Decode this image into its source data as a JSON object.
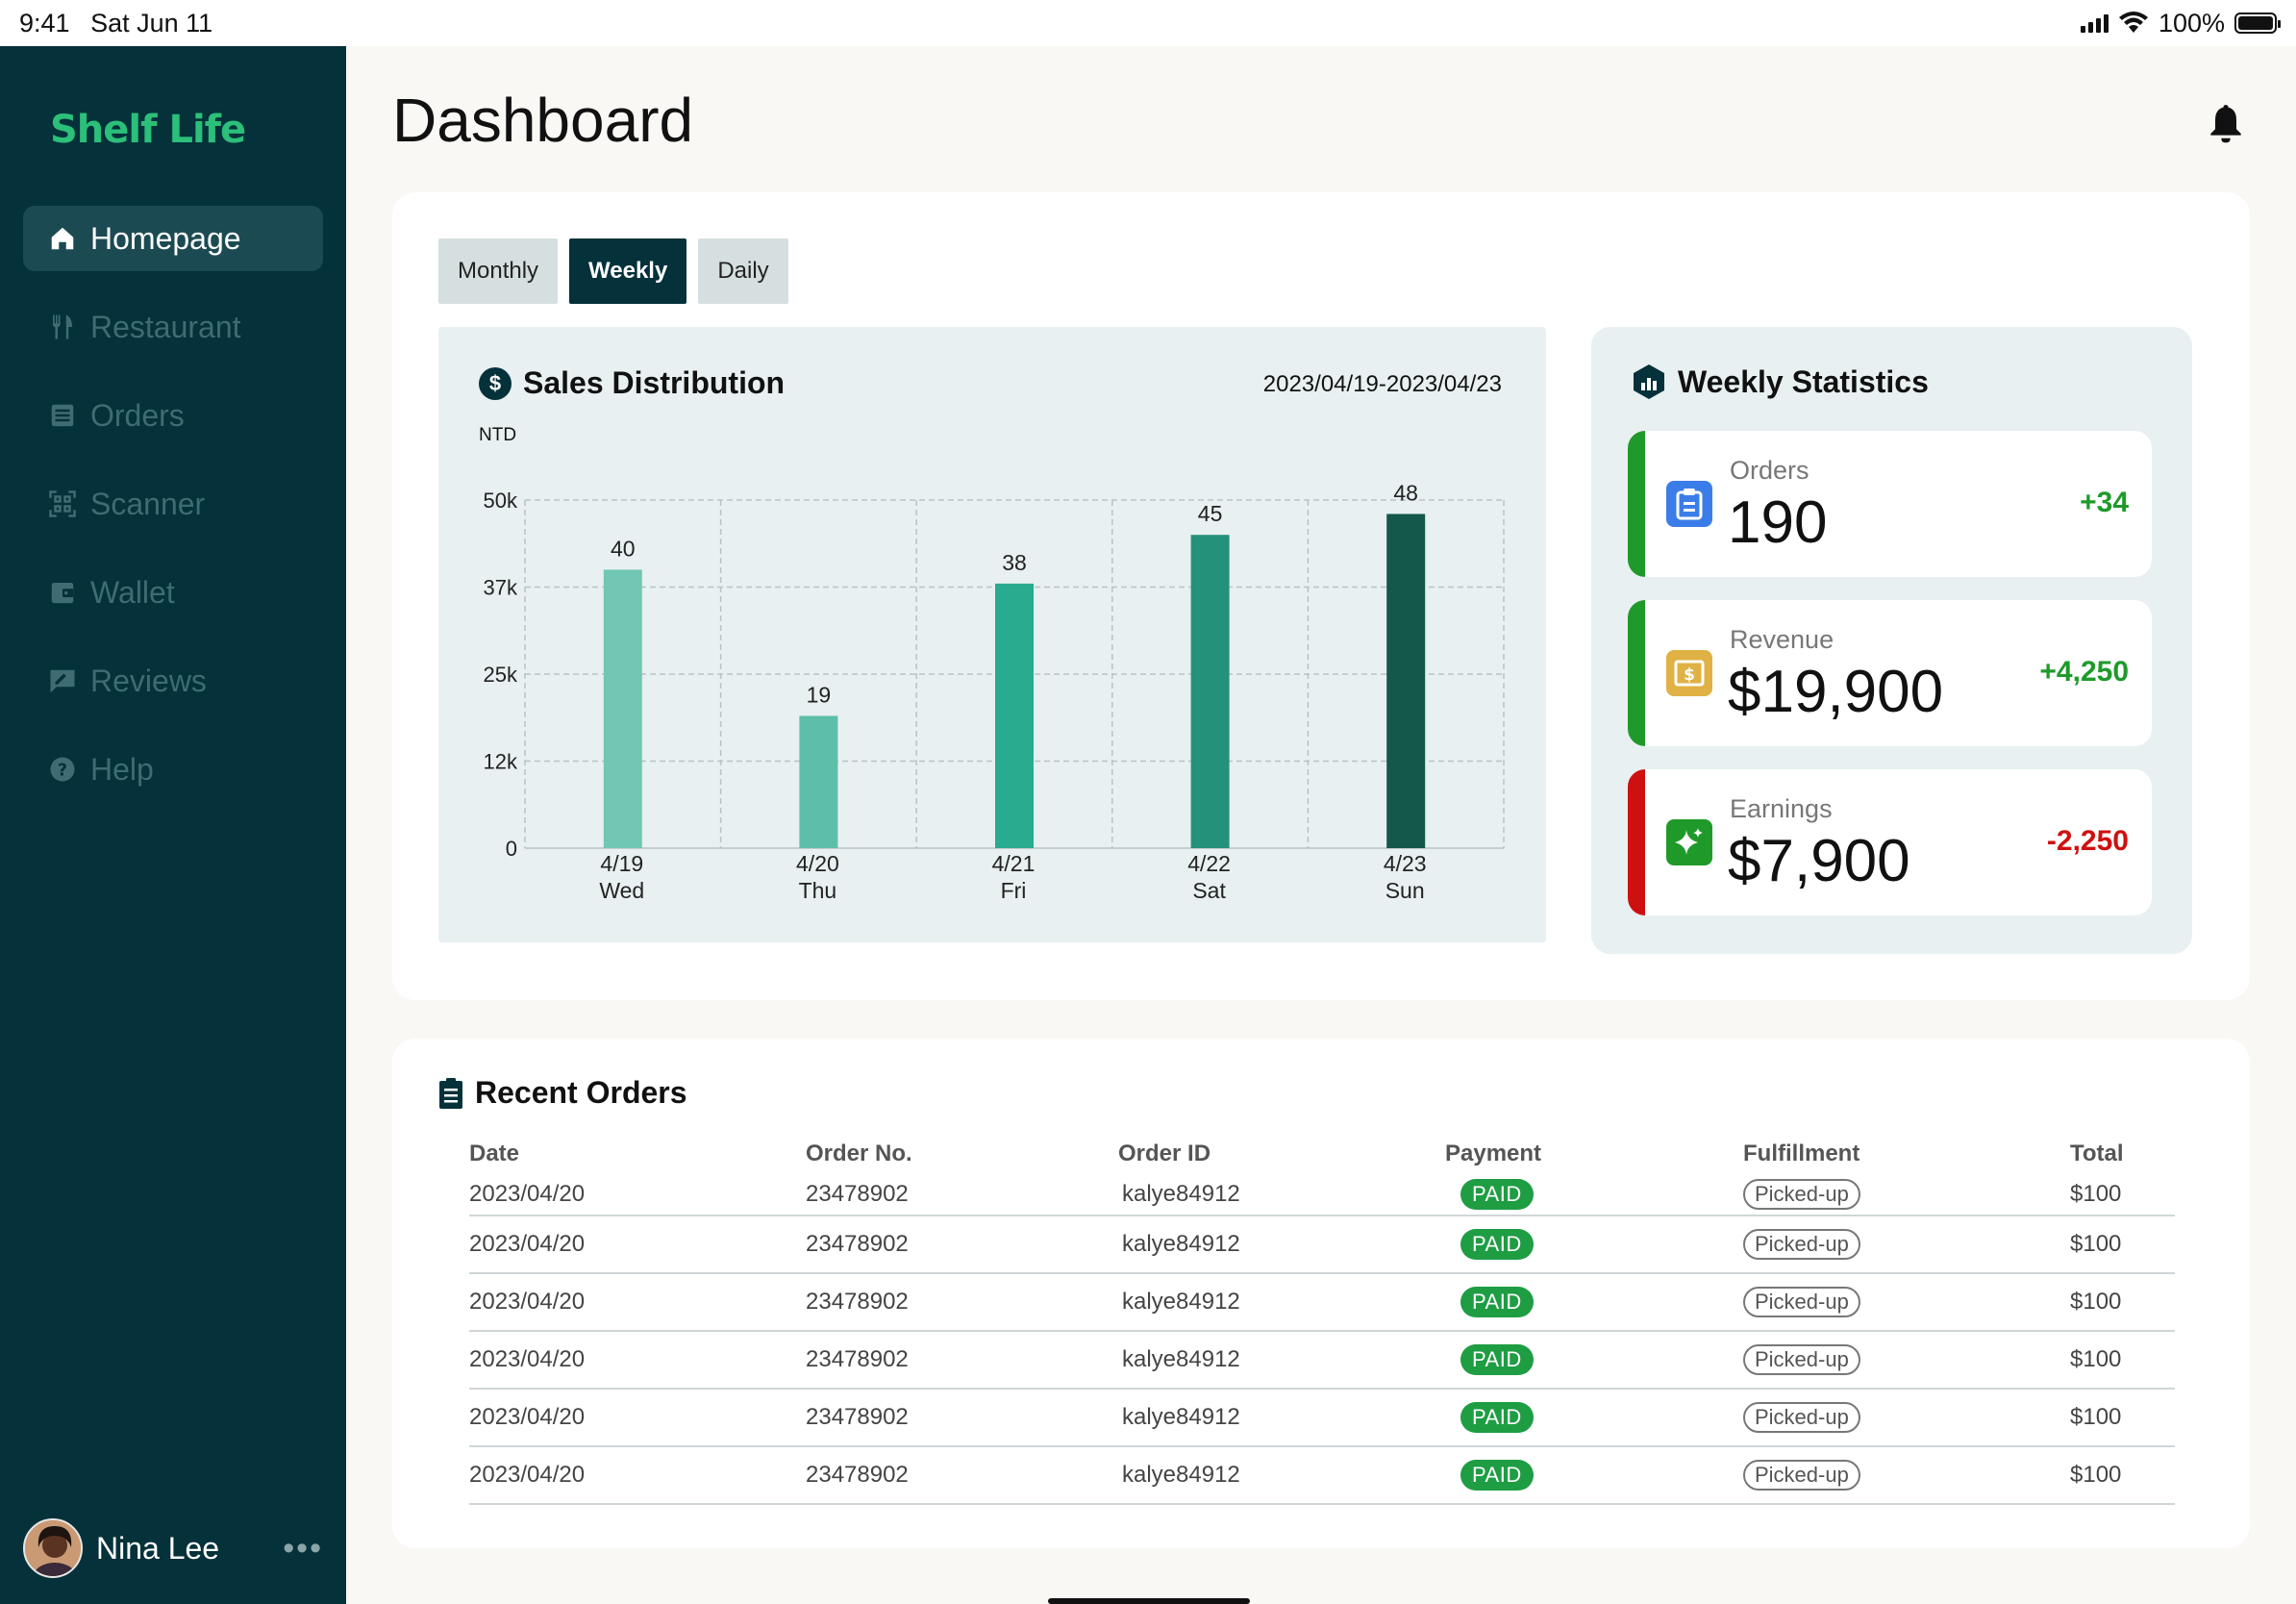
{
  "status": {
    "time": "9:41",
    "date": "Sat Jun 11",
    "battery": "100%"
  },
  "brand": "Shelf Life",
  "nav": [
    {
      "label": "Homepage",
      "icon": "home-icon",
      "active": true
    },
    {
      "label": "Restaurant",
      "icon": "utensils-icon"
    },
    {
      "label": "Orders",
      "icon": "list-icon"
    },
    {
      "label": "Scanner",
      "icon": "qr-scan-icon"
    },
    {
      "label": "Wallet",
      "icon": "wallet-icon"
    },
    {
      "label": "Reviews",
      "icon": "review-icon"
    },
    {
      "label": "Help",
      "icon": "help-icon"
    }
  ],
  "user": {
    "name": "Nina Lee",
    "more": "•••"
  },
  "page_title": "Dashboard",
  "tabs": [
    {
      "label": "Monthly"
    },
    {
      "label": "Weekly",
      "active": true
    },
    {
      "label": "Daily"
    }
  ],
  "sales": {
    "title": "Sales Distribution",
    "date_range": "2023/04/19-2023/04/23",
    "unit": "NTD"
  },
  "chart_data": {
    "type": "bar",
    "categories": [
      "4/19",
      "4/20",
      "4/21",
      "4/22",
      "4/23"
    ],
    "days": [
      "Wed",
      "Thu",
      "Fri",
      "Sat",
      "Sun"
    ],
    "values": [
      40,
      19,
      38,
      45,
      48
    ],
    "ylabel": "NTD",
    "yticks": [
      "0",
      "12k",
      "25k",
      "37k",
      "50k"
    ],
    "ylim": [
      0,
      50
    ],
    "colors": [
      "#72c7b4",
      "#5dbfa9",
      "#28ab8f",
      "#24917a",
      "#14574b"
    ],
    "grid": true
  },
  "weekly": {
    "title": "Weekly Statistics",
    "stats": [
      {
        "label": "Orders",
        "value": "190",
        "delta": "+34",
        "accent": "#1f9a2a",
        "delta_color": "#1f9a2a",
        "icon": "clipboard-icon",
        "icon_bg": "#3b7de8"
      },
      {
        "label": "Revenue",
        "value": "$19,900",
        "delta": "+4,250",
        "accent": "#1f9a2a",
        "delta_color": "#1f9a2a",
        "icon": "cash-icon",
        "icon_bg": "#e0b144"
      },
      {
        "label": "Earnings",
        "value": "$7,900",
        "delta": "-2,250",
        "accent": "#cf1010",
        "delta_color": "#cf1010",
        "icon": "sparkle-icon",
        "icon_bg": "#1f9a2a"
      }
    ]
  },
  "orders": {
    "title": "Recent Orders",
    "columns": [
      "Date",
      "Order No.",
      "Order ID",
      "Payment",
      "Fulfillment",
      "Total"
    ],
    "rows": [
      [
        "2023/04/20",
        "23478902",
        "kalye84912",
        "PAID",
        "Picked-up",
        "$100"
      ],
      [
        "2023/04/20",
        "23478902",
        "kalye84912",
        "PAID",
        "Picked-up",
        "$100"
      ],
      [
        "2023/04/20",
        "23478902",
        "kalye84912",
        "PAID",
        "Picked-up",
        "$100"
      ],
      [
        "2023/04/20",
        "23478902",
        "kalye84912",
        "PAID",
        "Picked-up",
        "$100"
      ],
      [
        "2023/04/20",
        "23478902",
        "kalye84912",
        "PAID",
        "Picked-up",
        "$100"
      ],
      [
        "2023/04/20",
        "23478902",
        "kalye84912",
        "PAID",
        "Picked-up",
        "$100"
      ]
    ]
  }
}
